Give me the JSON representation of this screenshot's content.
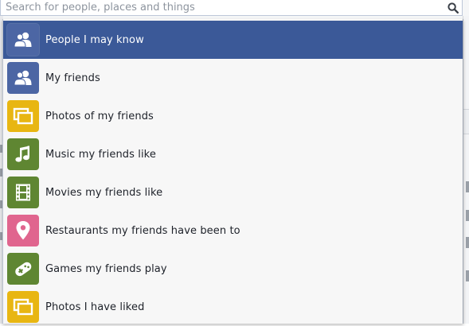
{
  "search": {
    "placeholder": "Search for people, places and things",
    "value": "",
    "icon": "search-icon"
  },
  "suggestions": [
    {
      "label": "People I may know",
      "icon": "people-icon",
      "color": "#4c66a4",
      "selected": true
    },
    {
      "label": "My friends",
      "icon": "people-icon",
      "color": "#4c66a4",
      "selected": false
    },
    {
      "label": "Photos of my friends",
      "icon": "photos-icon",
      "color": "#e8b612",
      "selected": false
    },
    {
      "label": "Music my friends like",
      "icon": "music-note-icon",
      "color": "#5f8632",
      "selected": false
    },
    {
      "label": "Movies my friends like",
      "icon": "film-strip-icon",
      "color": "#5f8632",
      "selected": false
    },
    {
      "label": "Restaurants my friends have been to",
      "icon": "map-pin-icon",
      "color": "#e0658e",
      "selected": false
    },
    {
      "label": "Games my friends play",
      "icon": "gamepad-icon",
      "color": "#5f8632",
      "selected": false
    },
    {
      "label": "Photos I have liked",
      "icon": "photos-icon",
      "color": "#e8b612",
      "selected": false
    }
  ],
  "colors": {
    "selected_background": "#3b5998",
    "dropdown_background": "#f7f7f7"
  }
}
